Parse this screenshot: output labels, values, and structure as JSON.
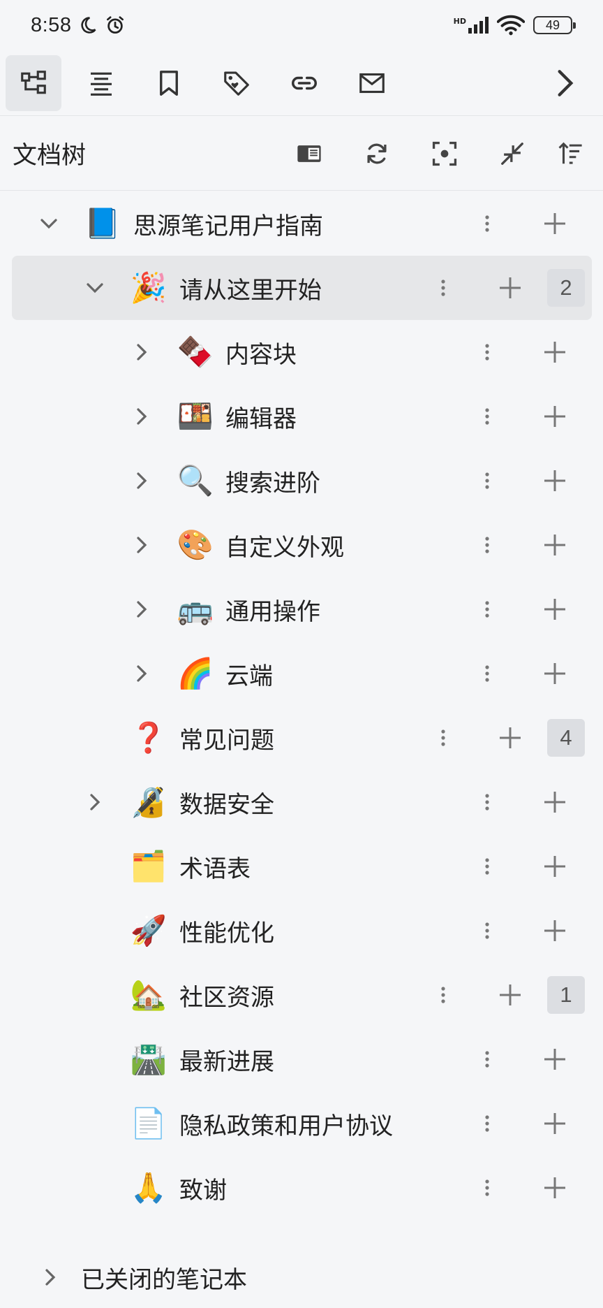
{
  "status": {
    "time": "8:58",
    "network": "HD",
    "battery": "49"
  },
  "tabs": [
    {
      "name": "doc-tree",
      "icon": "tree-icon"
    },
    {
      "name": "outline",
      "icon": "outline-icon"
    },
    {
      "name": "bookmarks",
      "icon": "bookmark-icon"
    },
    {
      "name": "tags",
      "icon": "tag-icon"
    },
    {
      "name": "backlinks",
      "icon": "link-icon"
    },
    {
      "name": "inbox",
      "icon": "mail-icon"
    }
  ],
  "panel": {
    "title": "文档树"
  },
  "tree": {
    "notebook": {
      "label": "思源笔记用户指南",
      "emoji": "📘"
    },
    "items": [
      {
        "label": "请从这里开始",
        "emoji": "🎉",
        "count": "2"
      },
      {
        "label": "内容块",
        "emoji": "🍫"
      },
      {
        "label": "编辑器",
        "emoji": "🍱"
      },
      {
        "label": "搜索进阶",
        "emoji": "🔍"
      },
      {
        "label": "自定义外观",
        "emoji": "🎨"
      },
      {
        "label": "通用操作",
        "emoji": "🚌"
      },
      {
        "label": "云端",
        "emoji": "🌈"
      },
      {
        "label": "常见问题",
        "emoji": "❓",
        "count": "4"
      },
      {
        "label": "数据安全",
        "emoji": "🔏"
      },
      {
        "label": "术语表",
        "emoji": "🗂️"
      },
      {
        "label": "性能优化",
        "emoji": "🚀"
      },
      {
        "label": "社区资源",
        "emoji": "🏡",
        "count": "1"
      },
      {
        "label": "最新进展",
        "emoji": "🛣️"
      },
      {
        "label": "隐私政策和用户协议",
        "emoji": "📄"
      },
      {
        "label": "致谢",
        "emoji": "🙏"
      }
    ]
  },
  "closed_notebooks": {
    "label": "已关闭的笔记本"
  }
}
